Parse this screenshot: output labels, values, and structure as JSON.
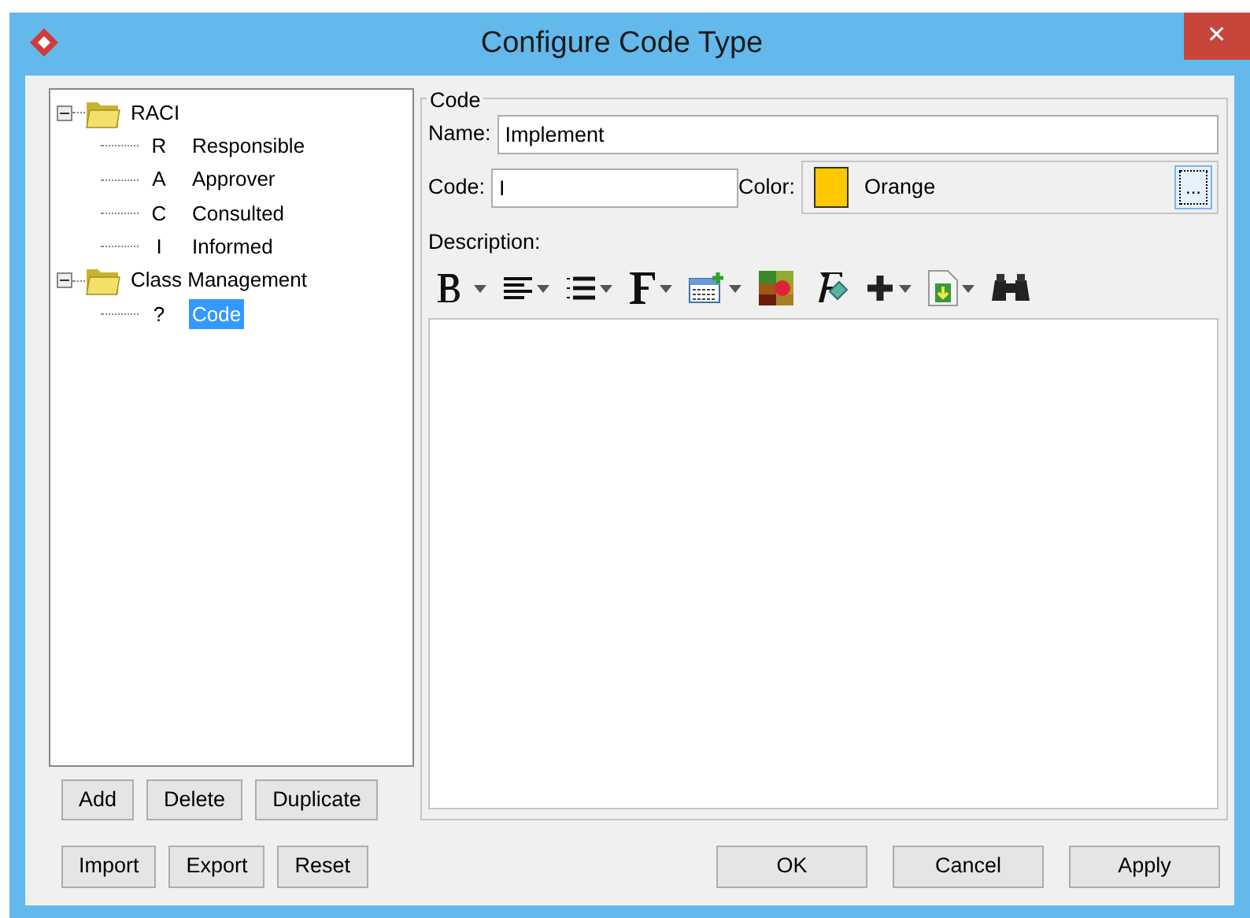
{
  "window": {
    "title": "Configure Code Type",
    "close": "✕"
  },
  "tree": [
    {
      "label": "RACI",
      "kind": "folder",
      "expanded": true,
      "children": [
        {
          "code": "R",
          "label": "Responsible",
          "kind": "code",
          "selected": false
        },
        {
          "code": "A",
          "label": "Approver",
          "kind": "code",
          "selected": false
        },
        {
          "code": "C",
          "label": "Consulted",
          "kind": "code",
          "selected": false
        },
        {
          "code": "I",
          "label": "Informed",
          "kind": "code",
          "selected": false
        }
      ]
    },
    {
      "label": "Class Management",
      "kind": "folder",
      "expanded": true,
      "children": [
        {
          "code": "?",
          "label": "Code",
          "kind": "code",
          "selected": true
        }
      ]
    }
  ],
  "tree_buttons": [
    "Add",
    "Delete",
    "Duplicate"
  ],
  "group": {
    "title": "Code",
    "name_label": "Name:",
    "name_value": "Implement",
    "code_label": "Code:",
    "code_value": "I",
    "color_label": "Color:",
    "color": "#ffc800",
    "color_name": "Orange",
    "color_button": "...",
    "description_label": "Description:"
  },
  "toolbar": [
    {
      "kind": "bold",
      "menu": true
    },
    {
      "kind": "align",
      "menu": true
    },
    {
      "kind": "list",
      "menu": true
    },
    {
      "kind": "font",
      "menu": true
    },
    {
      "kind": "table",
      "menu": true
    },
    {
      "kind": "palette",
      "menu": false
    },
    {
      "kind": "clear",
      "menu": false
    },
    {
      "kind": "plus",
      "menu": true
    },
    {
      "kind": "document",
      "menu": true
    },
    {
      "kind": "find",
      "menu": false
    }
  ],
  "bottom_left_buttons": [
    "Import",
    "Export",
    "Reset"
  ],
  "bottom_right_buttons": [
    "OK",
    "Cancel",
    "Apply"
  ]
}
